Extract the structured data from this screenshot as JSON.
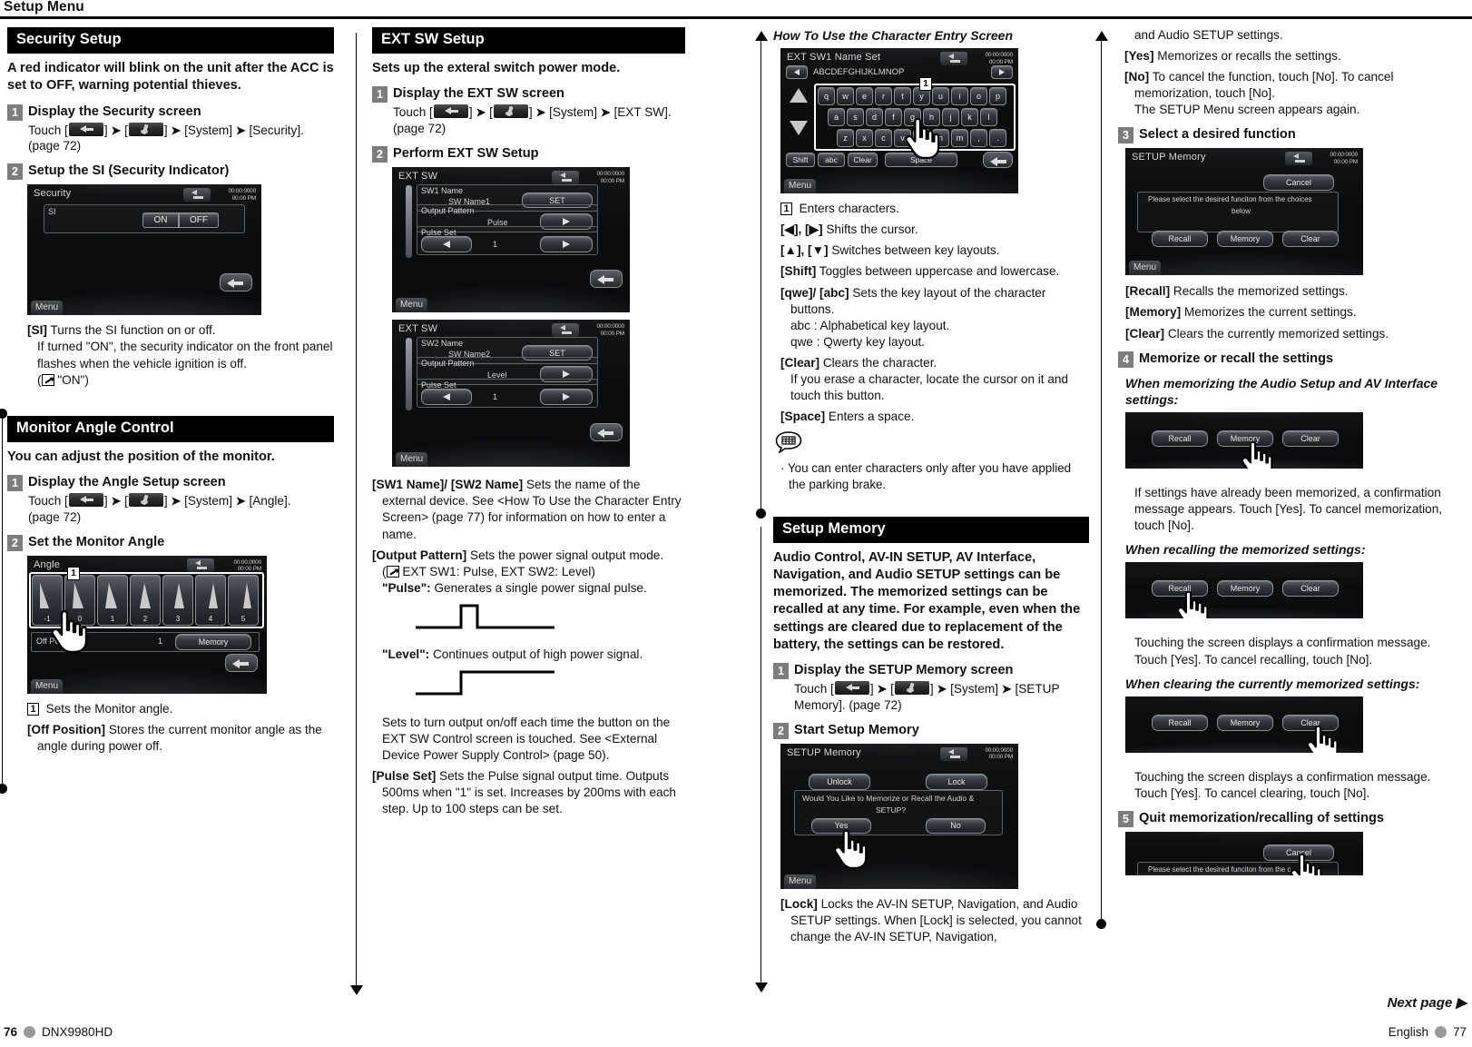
{
  "running_head": "Setup Menu",
  "footer": {
    "page_left": "76",
    "model": "DNX9980HD",
    "language": "English",
    "page_right": "77",
    "next_page": "Next page ▶"
  },
  "col1": {
    "security": {
      "header": "Security Setup",
      "lead": "A red indicator will blink on the unit after the ACC is set to OFF, warning potential thieves.",
      "step1": {
        "num": "1",
        "title": "Display the Security screen",
        "touch_prefix": "Touch [",
        "touch_mid": "] ",
        "system": "[System]",
        "target": "[Security].",
        "page_ref": "(page 72)"
      },
      "step2": {
        "num": "2",
        "title": "Setup the SI (Security Indicator)",
        "screen": {
          "title": "Security",
          "clock_line1": "00:00:0000",
          "clock_line2": "00:00 PM",
          "si_label": "SI",
          "on": "ON",
          "off": "OFF",
          "menu": "Menu"
        }
      },
      "defs": [
        {
          "term": "[SI]",
          "desc": "Turns the SI function on or off."
        }
      ],
      "si_detail1": "If turned \"ON\", the security indicator on the front panel flashes when the vehicle ignition is off.",
      "si_default": "\"ON\")"
    },
    "monitor": {
      "header": "Monitor Angle Control",
      "lead": "You can adjust the position of the monitor.",
      "step1": {
        "num": "1",
        "title": "Display the Angle Setup screen",
        "touch_prefix": "Touch [",
        "system": "[System]",
        "target": "[Angle].",
        "page_ref": "(page 72)"
      },
      "step2": {
        "num": "2",
        "title": "Set the Monitor Angle",
        "screen": {
          "title": "Angle",
          "clock_line1": "00:00:0000",
          "clock_line2": "00:00 PM",
          "angles": [
            "-1",
            "0",
            "1",
            "2",
            "3",
            "4",
            "5"
          ],
          "off_position": "Off Position",
          "off_value": "1",
          "memory": "Memory",
          "menu": "Menu",
          "callout": "1"
        }
      },
      "callout_desc": "Sets the Monitor angle.",
      "defs": [
        {
          "term": "[Off Position]",
          "desc": "Stores the current monitor angle as the angle during power off."
        }
      ]
    }
  },
  "col2": {
    "extsw": {
      "header": "EXT SW Setup",
      "lead": "Sets up the exteral switch power mode.",
      "step1": {
        "num": "1",
        "title": "Display the EXT SW screen",
        "touch_prefix": "Touch [",
        "system": "[System]",
        "target": "[EXT SW].",
        "page_ref": "(page 72)"
      },
      "step2": {
        "num": "2",
        "title": "Perform EXT SW Setup",
        "screen1": {
          "title": "EXT SW",
          "clock_line1": "00:00:0000",
          "clock_line2": "00:00 PM",
          "name_label": "SW1 Name",
          "name_value": "SW Name1",
          "set": "SET",
          "output_label": "Output Pattern",
          "output_value": "Pulse",
          "pulse_label": "Pulse Set",
          "pulse_value": "1",
          "menu": "Menu"
        },
        "screen2": {
          "title": "EXT SW",
          "clock_line1": "00:00:0000",
          "clock_line2": "00:00 PM",
          "name_label": "SW2 Name",
          "name_value": "SW Name2",
          "set": "SET",
          "output_label": "Output Pattern",
          "output_value": "Level",
          "pulse_label": "Pulse Set",
          "pulse_value": "1",
          "menu": "Menu"
        }
      },
      "def_swname_term": "[SW1 Name]/ [SW2 Name]",
      "def_swname_desc": "Sets the name of the external device. See <How To Use the Character Entry Screen> (page 77) for information on how to enter a name.",
      "def_output_term": "[Output Pattern]",
      "def_output_desc": "Sets the power signal output mode.",
      "def_output_default": "EXT SW1: Pulse, EXT SW2: Level)",
      "pulse_desc": "Generates a single power signal pulse.",
      "pulse_term": "\"Pulse\":",
      "level_term": "\"Level\":",
      "level_desc": "Continues output of high power signal.",
      "toggle_desc": "Sets to turn output on/off each time the button on the EXT SW Control screen is touched. See <External Device Power Supply Control> (page 50).",
      "def_pulseset_term": "[Pulse Set]",
      "def_pulseset_desc": "Sets the Pulse signal output time. Outputs 500ms when \"1\" is set. Increases by 200ms with each step. Up to 100 steps can be set."
    }
  },
  "col3": {
    "charentry": {
      "header": "How To Use the Character Entry Screen",
      "screen": {
        "title": "EXT SW1 Name Set",
        "clock_line1": "00:00:0000",
        "clock_line2": "00:00 PM",
        "entry_text": "ABCDEFGHIJKLMNOP",
        "row1": [
          "q",
          "w",
          "e",
          "r",
          "t",
          "y",
          "u",
          "i",
          "o",
          "p"
        ],
        "row2": [
          "a",
          "s",
          "d",
          "f",
          "g",
          "h",
          "j",
          "k",
          "l"
        ],
        "row3": [
          "z",
          "x",
          "c",
          "v",
          "b",
          "n",
          "m",
          ",",
          "."
        ],
        "shift": "Shift",
        "abc": "abc",
        "clear": "Clear",
        "space": "Space",
        "menu": "Menu",
        "callout": "1"
      },
      "callout_desc": "Enters characters.",
      "defs": [
        {
          "term": "[◀], [▶]",
          "desc": "Shifts the cursor."
        },
        {
          "term": "[▲], [▼]",
          "desc": "Switches between key layouts."
        },
        {
          "term": "[Shift]",
          "desc": "Toggles between uppercase and lowercase."
        },
        {
          "term": "[qwe]/ [abc]",
          "desc": "Sets the key layout of the character buttons."
        }
      ],
      "abc_line": "abc : Alphabetical key layout.",
      "qwe_line": "qwe : Qwerty key layout.",
      "clear_term": "[Clear]",
      "clear_desc": "Clears the character.",
      "clear_sub": "If you erase a character, locate the cursor on it and touch this button.",
      "space_term": "[Space]",
      "space_desc": "Enters a space.",
      "note": "You can enter characters only after you have applied the parking brake."
    },
    "setupmem": {
      "header": "Setup Memory",
      "lead": "Audio Control, AV-IN SETUP, AV Interface, Navigation, and Audio SETUP settings can be memorized. The memorized settings can be recalled at any time. For example, even when the settings are cleared due to replacement of the battery, the settings can be restored.",
      "step1": {
        "num": "1",
        "title": "Display the SETUP Memory screen",
        "touch_prefix": "Touch [",
        "system": "[System]",
        "target": "[SETUP Memory]. (page 72)"
      },
      "step2": {
        "num": "2",
        "title": "Start Setup Memory",
        "screen": {
          "title": "SETUP Memory",
          "clock_line1": "00:00:0000",
          "clock_line2": "00:00 PM",
          "unlock": "Unlock",
          "lock": "Lock",
          "message1": "Would You Like to Memorize or Recall the Audio &",
          "message2": "SETUP?",
          "yes": "Yes",
          "no": "No",
          "menu": "Menu"
        }
      },
      "lock_term": "[Lock]",
      "lock_desc": "Locks the AV-IN SETUP, Navigation, and Audio SETUP settings. When [Lock] is selected, you cannot change the AV-IN SETUP, Navigation,"
    }
  },
  "col4": {
    "cont_line": "and Audio SETUP settings.",
    "yes_term": "[Yes]",
    "yes_desc": "Memorizes or recalls the settings.",
    "no_term": "[No]",
    "no_desc": "To cancel the function, touch [No]. To cancel memorization, touch [No].",
    "no_sub": "The SETUP Menu screen appears again.",
    "step3": {
      "num": "3",
      "title": "Select a desired function",
      "screen": {
        "title": "SETUP Memory",
        "clock_line1": "00:00:0000",
        "clock_line2": "00:00 PM",
        "cancel": "Cancel",
        "message1": "Please select the desired funciton from the choices",
        "message2": "below",
        "recall": "Recall",
        "memory": "Memory",
        "clear": "Clear",
        "menu": "Menu"
      }
    },
    "defs": [
      {
        "term": "[Recall]",
        "desc": "Recalls the memorized settings."
      },
      {
        "term": "[Memory]",
        "desc": "Memorizes the current settings."
      },
      {
        "term": "[Clear]",
        "desc": "Clears the currently memorized settings."
      }
    ],
    "step4": {
      "num": "4",
      "title": "Memorize or recall the settings",
      "sub1_title": "When memorizing the Audio Setup and AV Interface settings:",
      "sub1_desc": "If settings have already been memorized, a confirmation message appears. Touch [Yes]. To cancel memorization, touch [No].",
      "sub2_title": "When recalling the memorized settings:",
      "sub2_desc": "Touching the screen displays a confirmation message. Touch [Yes]. To cancel recalling, touch [No].",
      "sub3_title": "When clearing the currently memorized settings:",
      "sub3_desc": "Touching the screen displays a confirmation message. Touch [Yes]. To cancel clearing, touch [No].",
      "buttons": {
        "recall": "Recall",
        "memory": "Memory",
        "clear": "Clear"
      }
    },
    "step5": {
      "num": "5",
      "title": "Quit memorization/recalling of settings",
      "screen": {
        "cancel": "Cancel",
        "message": "Please select the desired funciton from the c"
      }
    }
  }
}
